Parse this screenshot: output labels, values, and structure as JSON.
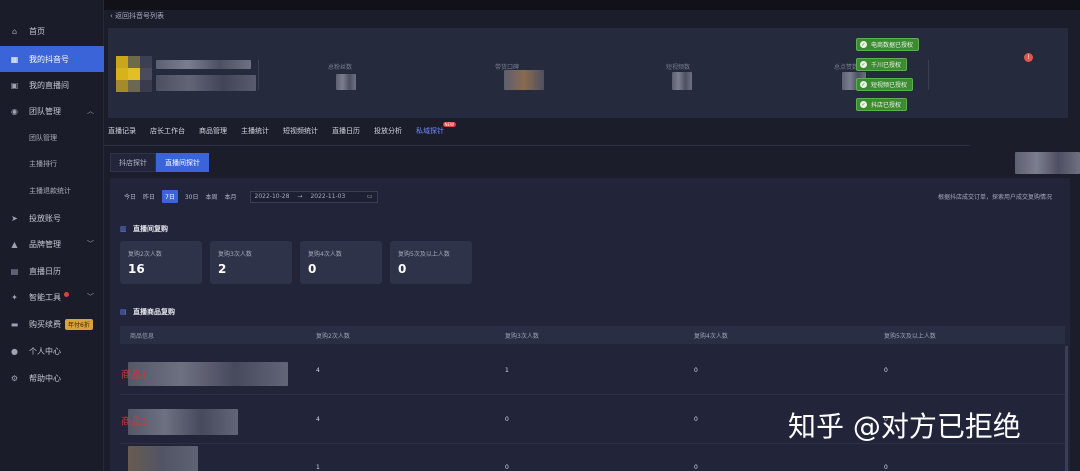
{
  "sidebar": {
    "items": [
      {
        "label": "首页",
        "icon": "home-icon"
      },
      {
        "label": "我的抖音号",
        "icon": "grid-icon"
      },
      {
        "label": "我的直播间",
        "icon": "live-icon"
      },
      {
        "label": "团队管理",
        "icon": "team-icon"
      },
      {
        "label": "团队管理",
        "icon": ""
      },
      {
        "label": "主播排行",
        "icon": ""
      },
      {
        "label": "主播退款统计",
        "icon": ""
      },
      {
        "label": "投放账号",
        "icon": "send-icon"
      },
      {
        "label": "品牌管理",
        "icon": "brand-icon"
      },
      {
        "label": "直播日历",
        "icon": "calendar-icon"
      },
      {
        "label": "智能工具",
        "icon": "tool-icon"
      },
      {
        "label": "购买续费",
        "icon": "card-icon",
        "badge": "年付6折"
      },
      {
        "label": "个人中心",
        "icon": "user-icon"
      },
      {
        "label": "帮助中心",
        "icon": "help-icon"
      }
    ]
  },
  "back_link": "返回抖音号列表",
  "profile": {
    "stats": [
      {
        "label": "总粉丝数"
      },
      {
        "label": "带货口碑"
      },
      {
        "label": "短视频数"
      },
      {
        "label": "总点赞数"
      }
    ],
    "auth_badges": [
      "电商数据已授权",
      "千川已授权",
      "短视频已授权",
      "抖店已授权"
    ]
  },
  "main_tabs": [
    "直播记录",
    "店长工作台",
    "商品管理",
    "主播统计",
    "短视频统计",
    "直播日历",
    "投放分析",
    "私域探针"
  ],
  "new_badge": "NEW",
  "sub_tabs": [
    "抖店探针",
    "直播间探针"
  ],
  "date_filter": {
    "options": [
      "今日",
      "昨日",
      "7日",
      "30日",
      "本周",
      "本月"
    ],
    "active": "7日",
    "start": "2022-10-28",
    "arrow": "→",
    "end": "2022-11-03"
  },
  "hint": "根据抖店成交订单，探索用户成交复购情况",
  "repurchase": {
    "title": "直播间复购",
    "metrics": [
      {
        "label": "复购2次人数",
        "value": "16"
      },
      {
        "label": "复购3次人数",
        "value": "2"
      },
      {
        "label": "复购4次人数",
        "value": "0"
      },
      {
        "label": "复购5次及以上人数",
        "value": "0"
      }
    ]
  },
  "product_repurchase": {
    "title": "直播商品复购",
    "columns": [
      "商品信息",
      "复购2次人数",
      "复购3次人数",
      "复购4次人数",
      "复购5次及以上人数"
    ],
    "rows": [
      {
        "name": "商品1",
        "c2": "4",
        "c3": "1",
        "c4": "0",
        "c5": "0"
      },
      {
        "name": "商品2",
        "c2": "4",
        "c3": "0",
        "c4": "0",
        "c5": "0"
      },
      {
        "name": "",
        "c2": "1",
        "c3": "0",
        "c4": "0",
        "c5": "0"
      }
    ]
  },
  "watermark": "知乎 @对方已拒绝"
}
